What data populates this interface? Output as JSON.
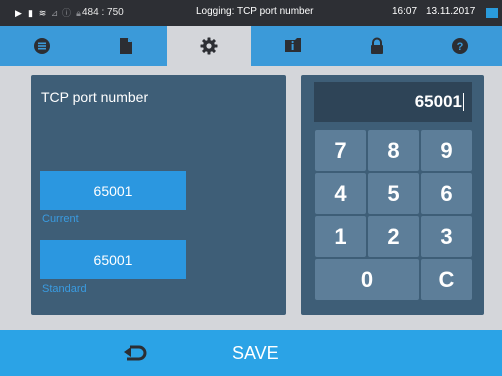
{
  "statusbar": {
    "icons": [
      "play-icon",
      "file-icon",
      "heat-icon",
      "chart-icon",
      "info-icon",
      "lock-icon"
    ],
    "coords": "484 : 750",
    "title": "Logging: TCP port number",
    "time": "16:07",
    "date": "13.11.2017"
  },
  "tabs": [
    {
      "icon": "menu-icon",
      "active": false
    },
    {
      "icon": "document-icon",
      "active": false
    },
    {
      "icon": "gear-icon",
      "active": true
    },
    {
      "icon": "info-icon",
      "active": false
    },
    {
      "icon": "lock-icon",
      "active": false
    },
    {
      "icon": "help-icon",
      "active": false
    }
  ],
  "panel": {
    "title": "TCP port number",
    "current_value": "65001",
    "current_label": "Current",
    "standard_value": "65001",
    "standard_label": "Standard"
  },
  "keypad": {
    "display_value": "65001",
    "keys": [
      "7",
      "8",
      "9",
      "4",
      "5",
      "6",
      "1",
      "2",
      "3",
      "0",
      "C"
    ]
  },
  "footer": {
    "back_icon": "return-arrow-icon",
    "save_label": "SAVE"
  },
  "colors": {
    "accent": "#2ba3e6",
    "panel": "#3e5e77",
    "key": "#5d7e99",
    "statusbar": "#2d2f34"
  }
}
